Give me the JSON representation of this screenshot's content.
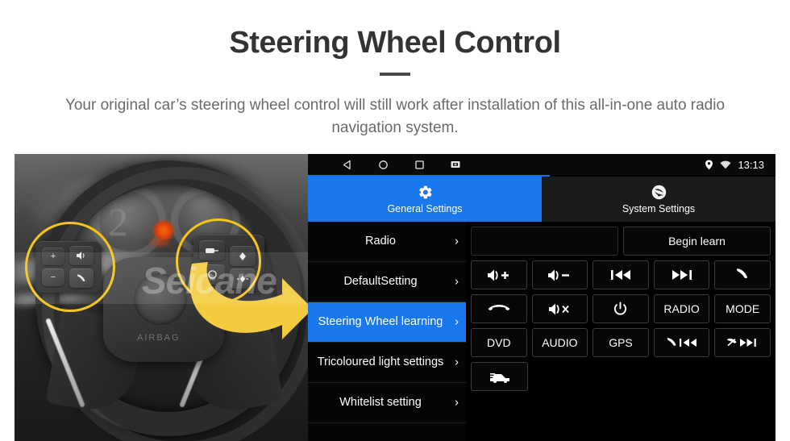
{
  "header": {
    "title": "Steering Wheel Control",
    "subtitle": "Your original car’s steering wheel control will still work after installation of this all-in-one auto radio navigation system."
  },
  "photo": {
    "watermark": "Seicane",
    "airbag_text": "AIRBAG",
    "highlight_circles": 2,
    "arrow_icon": "curved-right-arrow-icon",
    "left_cluster_buttons": [
      "volume-up-icon",
      "volume-down-icon",
      "voice-command-icon",
      "phone-call-icon"
    ],
    "right_cluster_buttons": [
      "cruise-set-icon",
      "cruise-resume-icon",
      "cruise-on-icon",
      "cruise-distance-icon"
    ]
  },
  "ui": {
    "statusbar": {
      "nav_icons": [
        "back-icon",
        "home-icon",
        "recents-icon",
        "screenshot-icon"
      ],
      "status_icons": [
        "location-pin-icon",
        "wifi-icon"
      ],
      "time": "13:13"
    },
    "tabs": [
      {
        "label": "General Settings",
        "icon": "gear-icon",
        "active": true
      },
      {
        "label": "System Settings",
        "icon": "brand-logo-icon",
        "active": false
      }
    ],
    "sidebar": {
      "items": [
        {
          "label": "Radio",
          "selected": false
        },
        {
          "label": "DefaultSetting",
          "selected": false
        },
        {
          "label": "Steering Wheel learning",
          "selected": true
        },
        {
          "label": "Tricoloured light settings",
          "selected": false
        },
        {
          "label": "Whitelist setting",
          "selected": false
        }
      ],
      "chevron": "›"
    },
    "panel": {
      "input_value": "",
      "begin_learn_label": "Begin learn",
      "rows": [
        [
          {
            "type": "input",
            "name": "learn-input",
            "label": ""
          },
          {
            "type": "button",
            "name": "begin-learn-button",
            "label": "Begin learn"
          }
        ],
        [
          {
            "type": "icon",
            "name": "volume-up-button",
            "icon": "volume-up-icon"
          },
          {
            "type": "icon",
            "name": "volume-down-button",
            "icon": "volume-down-icon"
          },
          {
            "type": "icon",
            "name": "previous-track-button",
            "icon": "previous-track-icon"
          },
          {
            "type": "icon",
            "name": "next-track-button",
            "icon": "next-track-icon"
          },
          {
            "type": "icon",
            "name": "answer-call-button",
            "icon": "phone-call-icon"
          }
        ],
        [
          {
            "type": "icon",
            "name": "hang-up-button",
            "icon": "phone-hangup-icon"
          },
          {
            "type": "icon",
            "name": "mute-button",
            "icon": "volume-mute-icon"
          },
          {
            "type": "icon",
            "name": "power-button",
            "icon": "power-icon"
          },
          {
            "type": "text",
            "name": "radio-button",
            "label": "RADIO"
          },
          {
            "type": "text",
            "name": "mode-button",
            "label": "MODE"
          }
        ],
        [
          {
            "type": "text",
            "name": "dvd-button",
            "label": "DVD"
          },
          {
            "type": "text",
            "name": "audio-button",
            "label": "AUDIO"
          },
          {
            "type": "text",
            "name": "gps-button",
            "label": "GPS"
          },
          {
            "type": "icon",
            "name": "call-previous-button",
            "icon": "call-previous-icon"
          },
          {
            "type": "icon",
            "name": "hangup-next-button",
            "icon": "hangup-next-icon"
          }
        ],
        [
          {
            "type": "icon",
            "name": "car-settings-button",
            "icon": "car-icon"
          }
        ]
      ]
    }
  },
  "colors": {
    "accent_blue": "#1a78ef",
    "highlight_yellow": "#f5c518",
    "arrow_yellow": "#f2cb3e",
    "title_gray": "#333333",
    "subtitle_gray": "#6a6a6a",
    "panel_black": "#000000"
  }
}
